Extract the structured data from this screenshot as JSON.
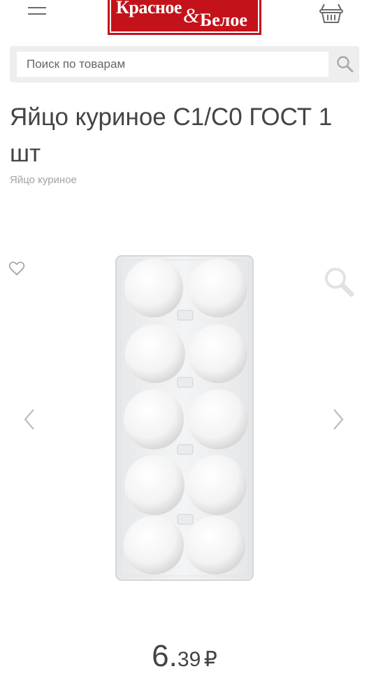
{
  "header": {
    "logo_word1": "Красное",
    "logo_amp": "&",
    "logo_word2": "Белое",
    "menu_icon": "hamburger-menu-icon",
    "cart_icon": "basket-icon"
  },
  "search": {
    "placeholder": "Поиск по товарам",
    "value": "",
    "icon": "search-icon"
  },
  "product": {
    "title": "Яйцо куриное С1/С0 ГОСТ 1 шт",
    "category": "Яйцо куриное",
    "price_int": "6",
    "price_sep": ".",
    "price_frac": "39",
    "currency": "₽",
    "wishlist_icon": "heart-icon",
    "zoom_icon": "magnifier-icon",
    "gallery_prev_icon": "chevron-left-icon",
    "gallery_next_icon": "chevron-right-icon"
  },
  "colors": {
    "brand_red": "#c4121a",
    "text": "#444444",
    "muted": "#a3a3a3",
    "icon_gray": "#bdbdbd"
  }
}
